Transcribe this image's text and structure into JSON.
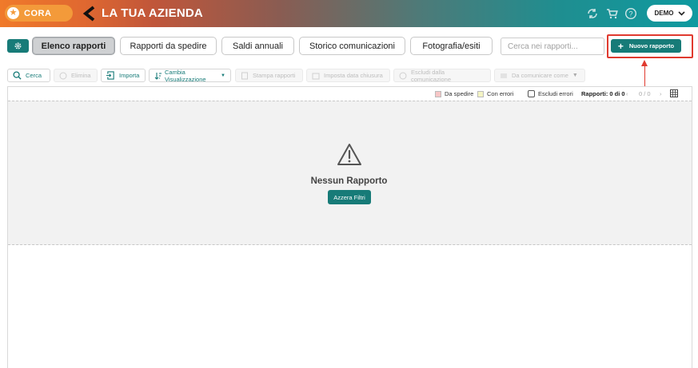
{
  "header": {
    "logo_text": "CORA",
    "company_title": "LA TUA AZIENDA",
    "user_label": "DEMO"
  },
  "tabs": [
    {
      "label": "Elenco rapporti",
      "active": true
    },
    {
      "label": "Rapporti da spedire",
      "active": false
    },
    {
      "label": "Saldi annuali",
      "active": false
    },
    {
      "label": "Storico comunicazioni",
      "active": false
    },
    {
      "label": "Fotografia/esiti",
      "active": false
    }
  ],
  "search": {
    "placeholder": "Cerca nei rapporti...",
    "value": ""
  },
  "new_report_label": "Nuovo rapporto",
  "toolbar": {
    "cerca": "Cerca",
    "elimina": "Elimina",
    "importa": "Importa",
    "cambia": "Cambia Visualizzazione",
    "stampa": "Stampa rapporti",
    "imposta": "Imposta data chiusura",
    "escludi": "Escludi dalla comunicazione",
    "comunicare": "Da comunicare come"
  },
  "legend": {
    "da_spedire": "Da spedire",
    "con_errori": "Con errori",
    "escludi_errori": "Escludi errori"
  },
  "table": {
    "count_label": "Rapporti: 0 di 0",
    "pager_text": "0 / 0"
  },
  "empty": {
    "title": "Nessun Rapporto",
    "reset_label": "Azzera Filtri"
  },
  "colors": {
    "primary": "#177b78",
    "highlight": "#e03a2f",
    "swatch_da_spedire": "#f7c6c6",
    "swatch_con_errori": "#f4f4c4"
  }
}
